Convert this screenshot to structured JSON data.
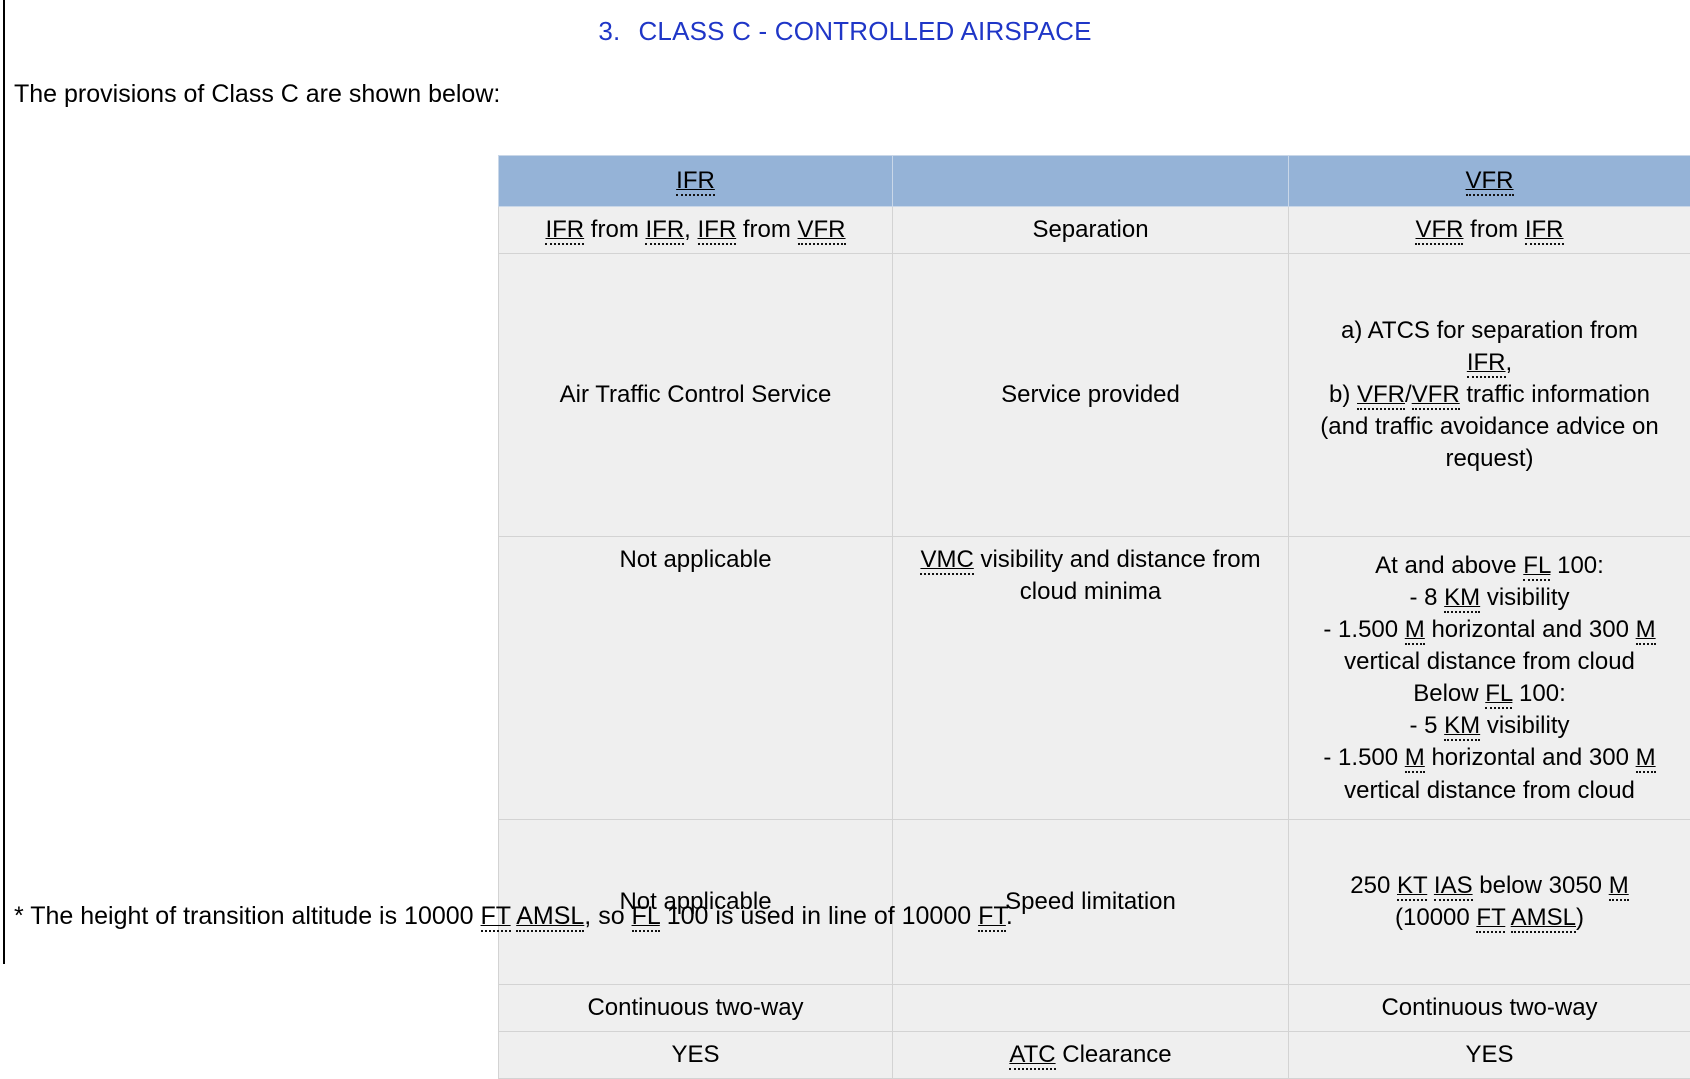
{
  "document": {
    "heading_number": "3.",
    "heading_title": "CLASS C - CONTROLLED AIRSPACE",
    "heading_color": "#1F36C7",
    "intro_text": "The provisions of Class C are shown below:",
    "footnote": "* The height of transition altitude is 10000 FT AMSL, so FL 100 is used in line of 10000 FT."
  },
  "table": {
    "header_bg": "#95B3D7",
    "cell_bg": "#EFEFEF",
    "border_color": "#D3D3D3",
    "columns": [
      "IFR",
      "",
      "VFR"
    ],
    "rows": [
      {
        "ifr": "IFR from IFR, IFR from VFR",
        "middle": "Separation",
        "vfr": "VFR from IFR"
      },
      {
        "ifr": "Air Traffic Control Service",
        "middle": "Service provided",
        "vfr": "a) ATCS for separation from IFR,\nb) VFR/VFR traffic information (and traffic avoidance advice on request)"
      },
      {
        "ifr": "Not applicable",
        "middle": "VMC visibility and distance from cloud minima",
        "vfr": "At and above FL 100:\n- 8 KM visibility\n- 1.500 M horizontal and 300 M vertical distance from cloud\nBelow FL 100:\n- 5 KM visibility\n- 1.500 M horizontal and 300 M vertical distance from cloud"
      },
      {
        "ifr": "Not applicable",
        "middle": "Speed limitation",
        "vfr": "250 KT IAS below 3050 M (10000 FT AMSL)"
      },
      {
        "ifr": "Continuous two-way",
        "middle": "",
        "vfr": "Continuous two-way"
      },
      {
        "ifr": "YES",
        "middle": "ATC Clearance",
        "vfr": "YES"
      }
    ]
  },
  "vfr_service_lines": {
    "line1_pre": "a) ATCS for separation from",
    "line2_abbr": "IFR",
    "line2_post": ",",
    "line3_pre": "b) ",
    "line3_abbr1": "VFR",
    "line3_slash": "/",
    "line3_abbr2": "VFR",
    "line3_post": " traffic information",
    "line4": "(and traffic avoidance advice on",
    "line5": "request)"
  },
  "vfr_vmc_lines": {
    "l1a": "At and above ",
    "l1b": "FL",
    "l1c": " 100:",
    "l2a": "- 8 ",
    "l2b": "KM",
    "l2c": " visibility",
    "l3a": "- 1.500 ",
    "l3b": "M",
    "l3c": " horizontal and 300 ",
    "l3d": "M",
    "l4": "vertical distance from cloud",
    "l5a": "Below ",
    "l5b": "FL",
    "l5c": " 100:",
    "l6a": "- 5 ",
    "l6b": "KM",
    "l6c": " visibility",
    "l7a": "- 1.500 ",
    "l7b": "M",
    "l7c": " horizontal and 300 ",
    "l7d": "M",
    "l8": "vertical distance from cloud"
  },
  "vfr_speed_lines": {
    "l1a": "250 ",
    "l1b": "KT",
    "l1c": " ",
    "l1d": "IAS",
    "l1e": " below 3050 ",
    "l1f": "M",
    "l2a": "(10000 ",
    "l2b": "FT",
    "l2c": " ",
    "l2d": "AMSL",
    "l2e": ")"
  },
  "ifr_separation_parts": {
    "a1": "IFR",
    "t1": " from ",
    "a2": "IFR",
    "t2": ", ",
    "a3": "IFR",
    "t3": " from ",
    "a4": "VFR"
  },
  "vfr_separation_parts": {
    "a1": "VFR",
    "t1": " from ",
    "a2": "IFR"
  },
  "vmc_middle_parts": {
    "a1": "VMC",
    "t1": " visibility and distance from cloud minima"
  },
  "atc_clearance_parts": {
    "a1": "ATC",
    "t1": " Clearance"
  },
  "footnote_parts": {
    "p1": "* The height of transition altitude is 10000 ",
    "a1": "FT",
    "p2": " ",
    "a2": "AMSL",
    "p3": ", so ",
    "a3": "FL",
    "p4": " 100 is used in line of 10000 ",
    "a4": "FT",
    "p5": "."
  },
  "labels": {
    "ifr_service": "Air Traffic Control Service",
    "middle_service": "Service provided",
    "not_applicable_1": "Not applicable",
    "not_applicable_2": "Not applicable",
    "middle_speed": "Speed limitation",
    "ifr_continuous": "Continuous two-way",
    "vfr_continuous": "Continuous two-way",
    "ifr_yes": "YES",
    "vfr_yes": "YES",
    "middle_separation": "Separation"
  }
}
